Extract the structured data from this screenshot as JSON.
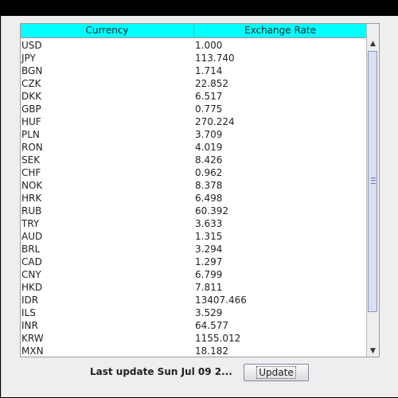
{
  "table": {
    "columns": [
      "Currency",
      "Exchange Rate"
    ],
    "rows": [
      [
        "USD",
        "1.000"
      ],
      [
        "JPY",
        "113.740"
      ],
      [
        "BGN",
        "1.714"
      ],
      [
        "CZK",
        "22.852"
      ],
      [
        "DKK",
        "6.517"
      ],
      [
        "GBP",
        "0.775"
      ],
      [
        "HUF",
        "270.224"
      ],
      [
        "PLN",
        "3.709"
      ],
      [
        "RON",
        "4.019"
      ],
      [
        "SEK",
        "8.426"
      ],
      [
        "CHF",
        "0.962"
      ],
      [
        "NOK",
        "8.378"
      ],
      [
        "HRK",
        "6.498"
      ],
      [
        "RUB",
        "60.392"
      ],
      [
        "TRY",
        "3.633"
      ],
      [
        "AUD",
        "1.315"
      ],
      [
        "BRL",
        "3.294"
      ],
      [
        "CAD",
        "1.297"
      ],
      [
        "CNY",
        "6.799"
      ],
      [
        "HKD",
        "7.811"
      ],
      [
        "IDR",
        "13407.466"
      ],
      [
        "ILS",
        "3.529"
      ],
      [
        "INR",
        "64.577"
      ],
      [
        "KRW",
        "1155.012"
      ],
      [
        "MXN",
        "18.182"
      ]
    ]
  },
  "scrollbar": {
    "up_icon": "arrow-up-icon",
    "down_icon": "arrow-down-icon",
    "up_glyph": "▲",
    "down_glyph": "▼"
  },
  "footer": {
    "last_update": "Last update Sun Jul 09 2...",
    "update_label": "Update"
  },
  "colors": {
    "header_bg": "#00ffff",
    "panel_bg": "#eeeeee",
    "window_frame": "#000000"
  }
}
